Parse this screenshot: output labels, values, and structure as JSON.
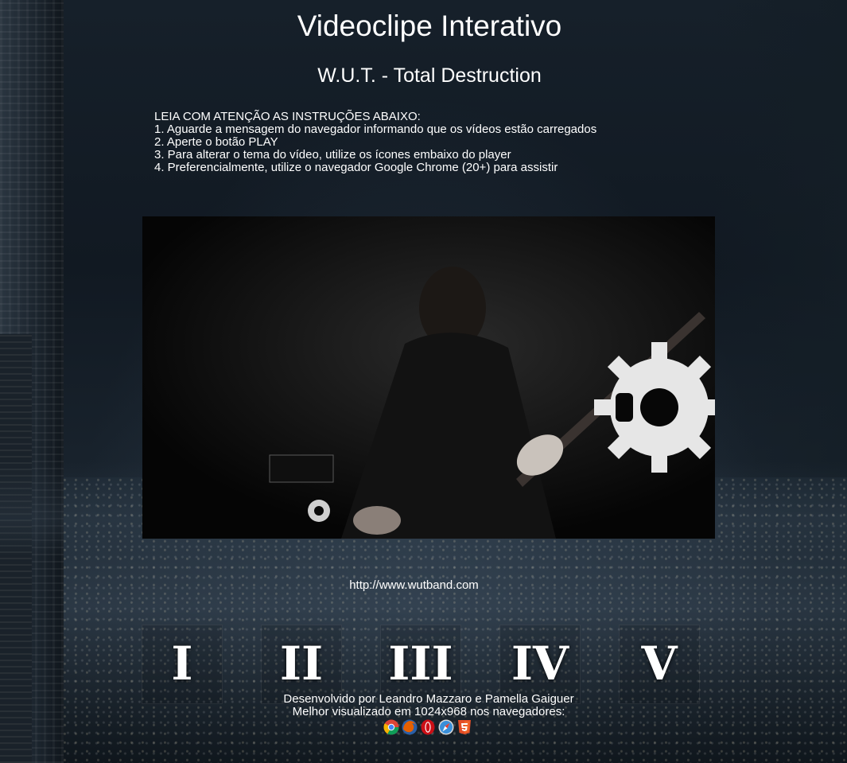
{
  "page": {
    "title": "Videoclipe Interativo",
    "subtitle": "W.U.T. - Total Destruction"
  },
  "instructions": {
    "text": "LEIA COM ATENÇÃO AS INSTRUÇÕES ABAIXO:\n1. Aguarde a mensagem do navegador informando que os vídeos estão carregados\n2. Aperte o botão PLAY\n3. Para alterar o tema do vídeo, utilize os ícones embaixo do player\n4. Preferencialmente, utilize o navegador Google Chrome (20+) para assistir"
  },
  "video": {
    "icon": "video-player"
  },
  "link": {
    "url": "http://www.wutband.com"
  },
  "themes": [
    {
      "label": "I"
    },
    {
      "label": "II"
    },
    {
      "label": "III"
    },
    {
      "label": "IV"
    },
    {
      "label": "V"
    }
  ],
  "footer": {
    "credits": "Desenvolvido por Leandro Mazzaro e Pamella Gaiguer",
    "best_viewed": "Melhor visualizado em 1024x968 nos navegadores:",
    "browsers": [
      "chrome-icon",
      "firefox-icon",
      "opera-icon",
      "safari-icon",
      "html5-icon"
    ]
  },
  "colors": {
    "text": "#ffffff",
    "background": "#111922",
    "video_bg": "#000000"
  }
}
